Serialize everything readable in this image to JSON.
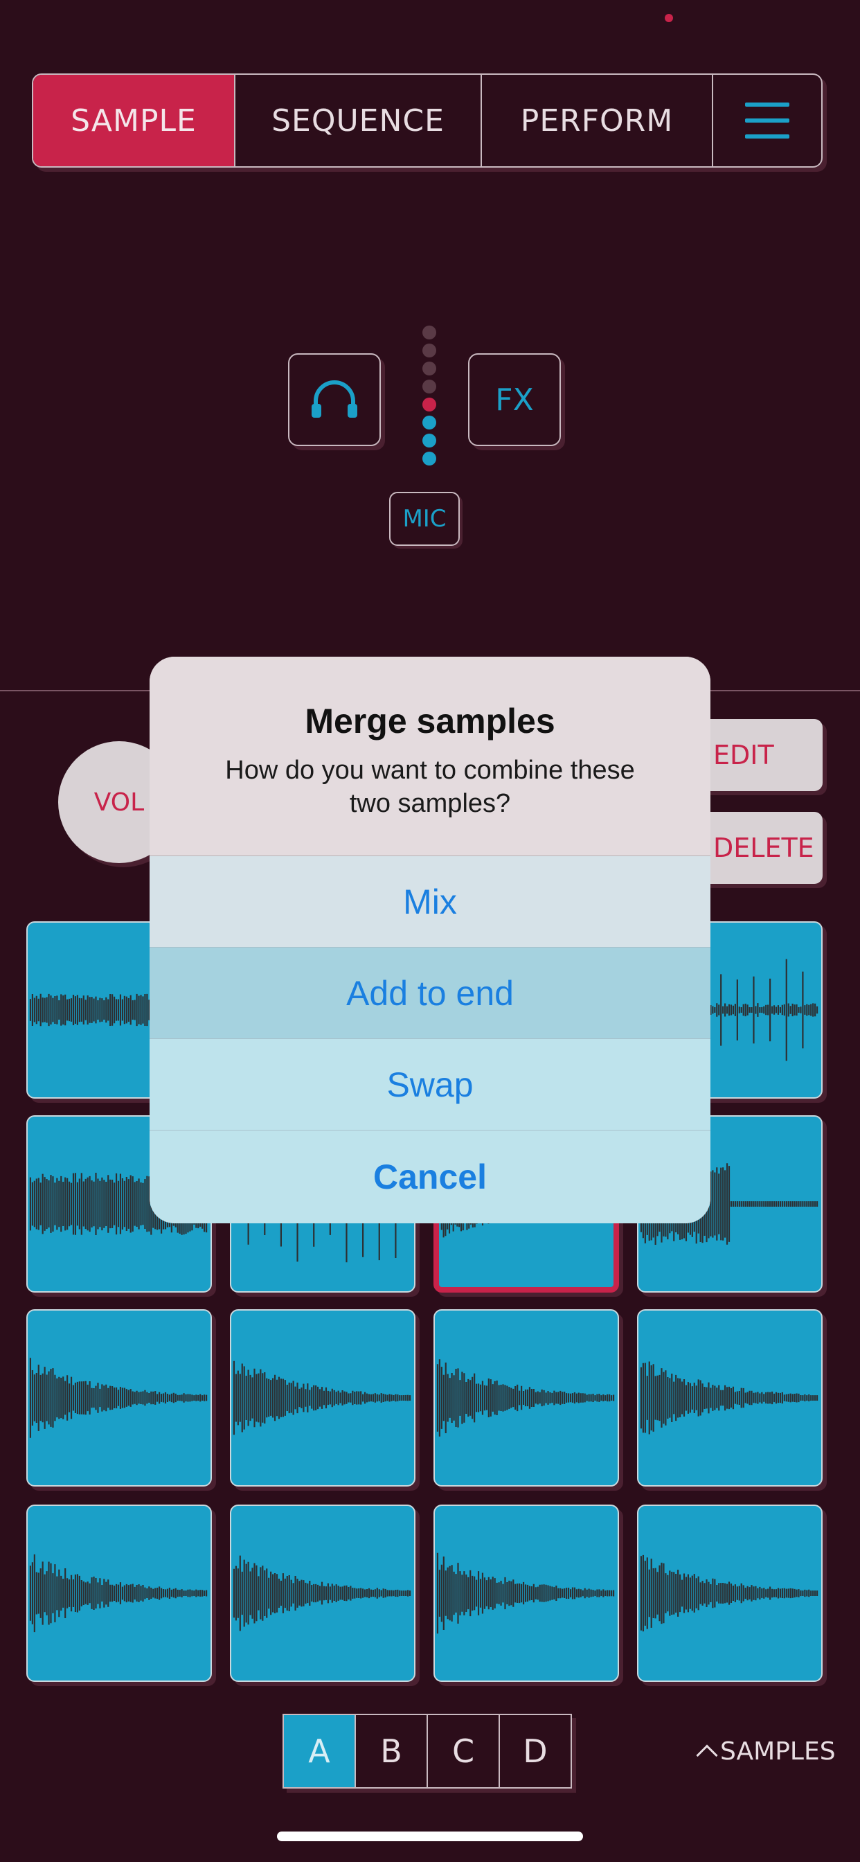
{
  "colors": {
    "background": "#2c0d1a",
    "accent_red": "#c8234a",
    "accent_blue": "#1ba0c8",
    "ios_blue": "#1a7fe0"
  },
  "tabs": [
    {
      "label": "SAMPLE",
      "active": true
    },
    {
      "label": "SEQUENCE",
      "active": false
    },
    {
      "label": "PERFORM",
      "active": false
    }
  ],
  "menu_icon": "hamburger-menu-icon",
  "monitor": {
    "headphones_icon": "headphones-icon",
    "fx_label": "FX",
    "mic_label": "MIC"
  },
  "controls": {
    "vol_label": "VOL",
    "edit_label": "EDIT",
    "delete_label": "DELETE"
  },
  "banks": [
    {
      "label": "A",
      "active": true
    },
    {
      "label": "B",
      "active": false
    },
    {
      "label": "C",
      "active": false
    },
    {
      "label": "D",
      "active": false
    }
  ],
  "samples_link": "SAMPLES",
  "dialog": {
    "title": "Merge samples",
    "message": "How do you want to combine these two samples?",
    "actions": [
      "Mix",
      "Add to end",
      "Swap",
      "Cancel"
    ]
  }
}
